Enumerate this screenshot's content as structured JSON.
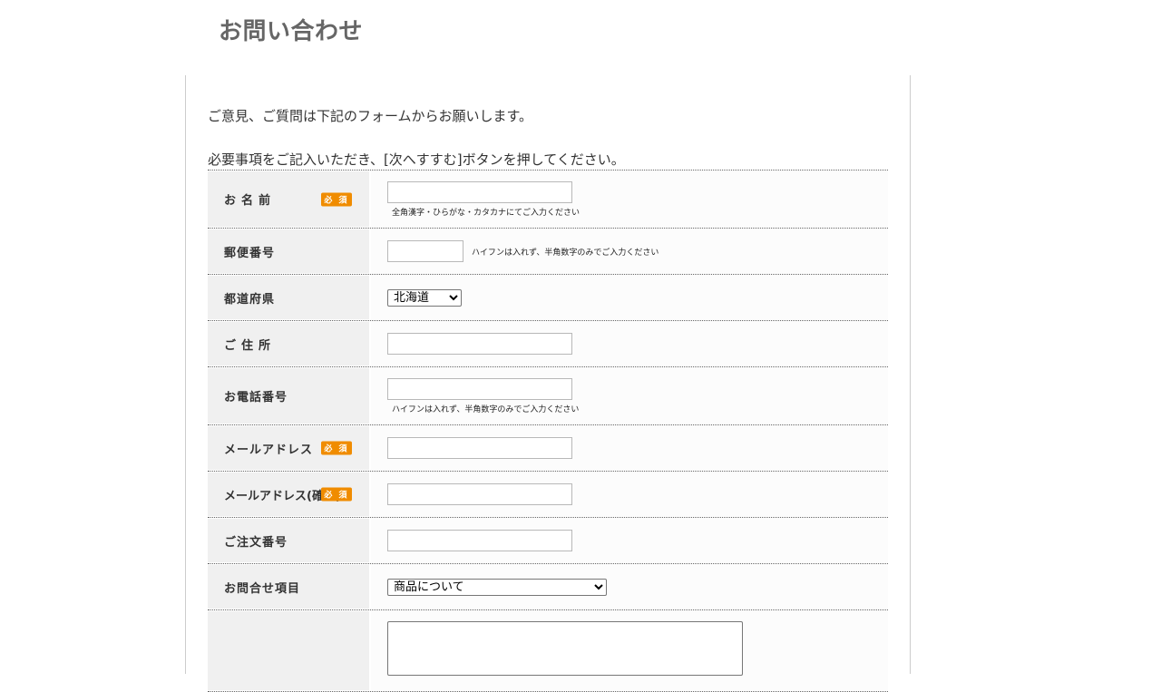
{
  "page": {
    "title": "お問い合わせ",
    "intro_line1": "ご意見、ご質問は下記のフォームからお願いします。",
    "intro_line2": "必要事項をご記入いただき、[次へすすむ]ボタンを押してください。"
  },
  "form": {
    "required_badge": "必 須",
    "name": {
      "label": "お名前",
      "value": "",
      "note": "全角漢字・ひらがな・カタカナにてご入力ください"
    },
    "postal": {
      "label": "郵便番号",
      "value": "",
      "note": "ハイフンは入れず、半角数字のみでご入力ください"
    },
    "prefecture": {
      "label": "都道府県",
      "selected": "北海道"
    },
    "address": {
      "label": "ご住所",
      "value": ""
    },
    "phone": {
      "label": "お電話番号",
      "value": "",
      "note": "ハイフンは入れず、半角数字のみでご入力ください"
    },
    "email": {
      "label": "メールアドレス",
      "value": ""
    },
    "email_confirm": {
      "label": "メールアドレス(確認)",
      "value": ""
    },
    "order_number": {
      "label": "ご注文番号",
      "value": ""
    },
    "inquiry_type": {
      "label": "お問合せ項目",
      "selected": "商品について"
    },
    "message": {
      "label": "",
      "value": ""
    }
  },
  "colors": {
    "badge": "#f08c00",
    "label_bg": "#f0f0f0",
    "title": "#666666"
  }
}
